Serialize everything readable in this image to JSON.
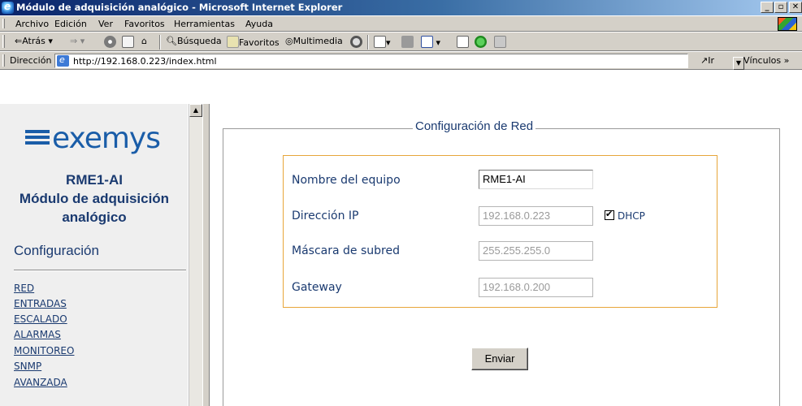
{
  "window": {
    "title": "Módulo de adquisición analógico - Microsoft Internet Explorer"
  },
  "menu": [
    "Archivo",
    "Edición",
    "Ver",
    "Favoritos",
    "Herramientas",
    "Ayuda"
  ],
  "toolbar": {
    "back": "Atrás",
    "search": "Búsqueda",
    "favorites": "Favoritos",
    "multimedia": "Multimedia"
  },
  "address": {
    "label": "Dirección",
    "url": "http://192.168.0.223/index.html",
    "go": "Ir",
    "links": "Vínculos"
  },
  "sidebar": {
    "logo_text": "exemys",
    "device_name": "RME1-AI",
    "device_desc_1": "Módulo de adquisición",
    "device_desc_2": "analógico",
    "section_title": "Configuración",
    "links": [
      "RED",
      "ENTRADAS",
      "ESCALADO",
      "ALARMAS",
      "MONITOREO",
      "SNMP",
      "AVANZADA"
    ]
  },
  "form": {
    "legend": "Configuración de Red",
    "fields": [
      {
        "label": "Nombre del equipo",
        "value": "RME1-AI",
        "enabled": true
      },
      {
        "label": "Dirección IP",
        "value": "192.168.0.223",
        "enabled": false
      },
      {
        "label": "Máscara de subred",
        "value": "255.255.255.0",
        "enabled": false
      },
      {
        "label": "Gateway",
        "value": "192.168.0.200",
        "enabled": false
      }
    ],
    "dhcp_label": "DHCP",
    "dhcp_checked": true,
    "submit": "Enviar"
  },
  "colors": {
    "accent_text": "#1a3a70",
    "logo": "#1a5da8",
    "inner_border": "#e7a63a"
  }
}
